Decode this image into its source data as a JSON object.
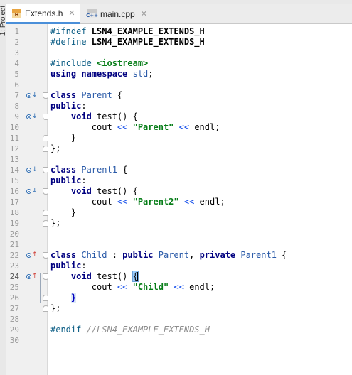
{
  "toolwindow": {
    "label": "1: Project"
  },
  "tabs": [
    {
      "name": "Extends.h",
      "icon_text": "H",
      "active": true
    },
    {
      "name": "main.cpp",
      "icon_text": "C++",
      "active": false
    }
  ],
  "editor": {
    "current_line": 24,
    "lines": [
      {
        "n": "1",
        "parts": [
          [
            "pp",
            "#ifndef "
          ],
          [
            "macro",
            "LSN4_EXAMPLE_EXTENDS_H"
          ]
        ]
      },
      {
        "n": "2",
        "parts": [
          [
            "pp",
            "#define "
          ],
          [
            "macro",
            "LSN4_EXAMPLE_EXTENDS_H"
          ]
        ]
      },
      {
        "n": "3",
        "parts": []
      },
      {
        "n": "4",
        "parts": [
          [
            "pp",
            "#include "
          ],
          [
            "inc",
            "<iostream>"
          ]
        ]
      },
      {
        "n": "5",
        "parts": [
          [
            "kw",
            "using namespace "
          ],
          [
            "type",
            "std"
          ],
          [
            "ident",
            ";"
          ]
        ]
      },
      {
        "n": "6",
        "parts": []
      },
      {
        "n": "7",
        "parts": [
          [
            "kw",
            "class "
          ],
          [
            "type",
            "Parent"
          ],
          [
            "ident",
            " {"
          ]
        ]
      },
      {
        "n": "8",
        "parts": [
          [
            "kw",
            "public"
          ],
          [
            "ident",
            ":"
          ]
        ]
      },
      {
        "n": "9",
        "parts": [
          [
            "ident",
            "    "
          ],
          [
            "kw",
            "void "
          ],
          [
            "ident",
            "test() {"
          ]
        ]
      },
      {
        "n": "10",
        "parts": [
          [
            "ident",
            "        cout "
          ],
          [
            "op",
            "<<"
          ],
          [
            "ident",
            " "
          ],
          [
            "str",
            "\"Parent\""
          ],
          [
            "ident",
            " "
          ],
          [
            "op",
            "<<"
          ],
          [
            "ident",
            " endl;"
          ]
        ]
      },
      {
        "n": "11",
        "parts": [
          [
            "ident",
            "    }"
          ]
        ]
      },
      {
        "n": "12",
        "parts": [
          [
            "ident",
            "};"
          ]
        ]
      },
      {
        "n": "13",
        "parts": []
      },
      {
        "n": "14",
        "parts": [
          [
            "kw",
            "class "
          ],
          [
            "type",
            "Parent1"
          ],
          [
            "ident",
            " {"
          ]
        ]
      },
      {
        "n": "15",
        "parts": [
          [
            "kw",
            "public"
          ],
          [
            "ident",
            ":"
          ]
        ]
      },
      {
        "n": "16",
        "parts": [
          [
            "ident",
            "    "
          ],
          [
            "kw",
            "void "
          ],
          [
            "ident",
            "test() {"
          ]
        ]
      },
      {
        "n": "17",
        "parts": [
          [
            "ident",
            "        cout "
          ],
          [
            "op",
            "<<"
          ],
          [
            "ident",
            " "
          ],
          [
            "str",
            "\"Parent2\""
          ],
          [
            "ident",
            " "
          ],
          [
            "op",
            "<<"
          ],
          [
            "ident",
            " endl;"
          ]
        ]
      },
      {
        "n": "18",
        "parts": [
          [
            "ident",
            "    }"
          ]
        ]
      },
      {
        "n": "19",
        "parts": [
          [
            "ident",
            "};"
          ]
        ]
      },
      {
        "n": "20",
        "parts": []
      },
      {
        "n": "21",
        "parts": []
      },
      {
        "n": "22",
        "parts": [
          [
            "kw",
            "class "
          ],
          [
            "type",
            "Child"
          ],
          [
            "ident",
            " : "
          ],
          [
            "kw",
            "public "
          ],
          [
            "type",
            "Parent"
          ],
          [
            "ident",
            ", "
          ],
          [
            "kw",
            "private "
          ],
          [
            "type",
            "Parent1"
          ],
          [
            "ident",
            " {"
          ]
        ]
      },
      {
        "n": "23",
        "parts": [
          [
            "kw",
            "public"
          ],
          [
            "ident",
            ":"
          ]
        ]
      },
      {
        "n": "24",
        "parts": [
          [
            "ident",
            "    "
          ],
          [
            "kw",
            "void "
          ],
          [
            "ident",
            "test() "
          ],
          [
            "brace-hl",
            "{"
          ]
        ]
      },
      {
        "n": "25",
        "parts": [
          [
            "ident",
            "        cout "
          ],
          [
            "op",
            "<<"
          ],
          [
            "ident",
            " "
          ],
          [
            "str",
            "\"Child\""
          ],
          [
            "ident",
            " "
          ],
          [
            "op",
            "<<"
          ],
          [
            "ident",
            " endl;"
          ]
        ]
      },
      {
        "n": "26",
        "parts": [
          [
            "ident",
            "    "
          ],
          [
            "brace-hl2",
            "}"
          ]
        ]
      },
      {
        "n": "27",
        "parts": [
          [
            "ident",
            "};"
          ]
        ]
      },
      {
        "n": "28",
        "parts": []
      },
      {
        "n": "29",
        "parts": [
          [
            "pp",
            "#endif "
          ],
          [
            "cmt",
            "//LSN4_EXAMPLE_EXTENDS_H"
          ]
        ]
      },
      {
        "n": "30",
        "parts": []
      }
    ],
    "markers": [
      {
        "line": 7,
        "kind": "down",
        "arrow": "↓"
      },
      {
        "line": 9,
        "kind": "down",
        "arrow": "↓"
      },
      {
        "line": 14,
        "kind": "down",
        "arrow": "↓"
      },
      {
        "line": 16,
        "kind": "down",
        "arrow": "↓"
      },
      {
        "line": 22,
        "kind": "up",
        "arrow": "↑"
      },
      {
        "line": 24,
        "kind": "up",
        "arrow": "↑"
      }
    ],
    "folds": [
      {
        "line": 7,
        "kind": "start"
      },
      {
        "line": 9,
        "kind": "start"
      },
      {
        "line": 11,
        "kind": "end"
      },
      {
        "line": 12,
        "kind": "end"
      },
      {
        "line": 14,
        "kind": "start"
      },
      {
        "line": 16,
        "kind": "start"
      },
      {
        "line": 18,
        "kind": "end"
      },
      {
        "line": 19,
        "kind": "end"
      },
      {
        "line": 22,
        "kind": "start"
      },
      {
        "line": 24,
        "kind": "start"
      },
      {
        "line": 26,
        "kind": "end"
      },
      {
        "line": 27,
        "kind": "end"
      }
    ]
  }
}
